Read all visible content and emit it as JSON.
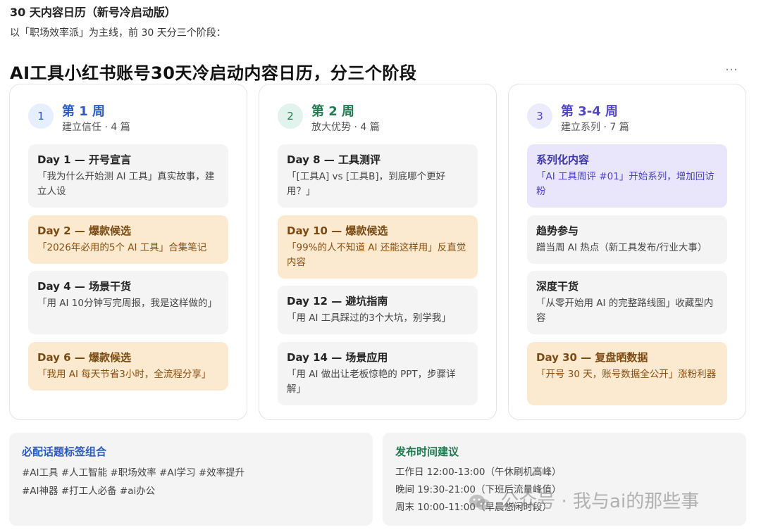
{
  "header": {
    "top_title": "30 天内容日历（新号冷启动版）",
    "intro": "以「职场效率派」为主线，前 30 天分三个阶段：",
    "main_title": "AI工具小红书账号30天冷启动内容日历，分三个阶段",
    "more_icon": "…"
  },
  "columns": [
    {
      "num": "1",
      "title": "第 1 周",
      "subtitle": "建立信任 · 4 篇",
      "cards": [
        {
          "title": "Day 1 — 开号宣言",
          "desc": "「我为什么开始测 AI 工具」真实故事，建立人设",
          "style": "gray"
        },
        {
          "title": "Day 2 — 爆款候选",
          "desc": "「2026年必用的5个 AI 工具」合集笔记",
          "style": "orange"
        },
        {
          "title": "Day 4 — 场景干货",
          "desc": "「用 AI 10分钟写完周报，我是这样做的」",
          "style": "gray"
        },
        {
          "title": "Day 6 — 爆款候选",
          "desc": "「我用 AI 每天节省3小时，全流程分享」",
          "style": "orange"
        }
      ]
    },
    {
      "num": "2",
      "title": "第 2 周",
      "subtitle": "放大优势 · 4 篇",
      "cards": [
        {
          "title": "Day 8 — 工具测评",
          "desc": "「[工具A] vs [工具B]，到底哪个更好用？」",
          "style": "gray"
        },
        {
          "title": "Day 10 — 爆款候选",
          "desc": "「99%的人不知道 AI 还能这样用」反直觉内容",
          "style": "orange"
        },
        {
          "title": "Day 12 — 避坑指南",
          "desc": "「用 AI 工具踩过的3个大坑，别学我」",
          "style": "gray"
        },
        {
          "title": "Day 14 — 场景应用",
          "desc": "「用 AI 做出让老板惊艳的 PPT，步骤详解」",
          "style": "gray"
        }
      ]
    },
    {
      "num": "3",
      "title": "第 3-4 周",
      "subtitle": "建立系列 · 7 篇",
      "cards": [
        {
          "title": "系列化内容",
          "desc": "「AI 工具周评 #01」开始系列，增加回访粉",
          "style": "purple"
        },
        {
          "title": "趋势参与",
          "desc": "蹭当周 AI 热点（新工具发布/行业大事）",
          "style": "gray"
        },
        {
          "title": "深度干货",
          "desc": "「从零开始用 AI 的完整路线图」收藏型内容",
          "style": "gray"
        },
        {
          "title": "Day 30 — 复盘晒数据",
          "desc": "「开号 30 天，账号数据全公开」涨粉利器",
          "style": "orange"
        }
      ]
    }
  ],
  "tags_panel": {
    "title": "必配话题标签组合",
    "line1": "#AI工具 #人工智能 #职场效率 #AI学习 #效率提升",
    "line2": "#AI神器 #打工人必备 #ai办公"
  },
  "time_panel": {
    "title": "发布时间建议",
    "line1": "工作日 12:00-13:00（午休刷机高峰）",
    "line2": "晚间 19:30-21:00（下班后流量峰值）",
    "line3": "周末 10:00-11:00（早晨悠闲时段）"
  },
  "watermark": {
    "text": "公众号 · 我与ai的那些事",
    "icon": "wechat-icon"
  },
  "colors": {
    "week1": "#2a5bc2",
    "week2": "#1f7a4f",
    "week3": "#5146c7",
    "orange_card": "#fbead0",
    "gray_card": "#f4f4f4",
    "purple_card": "#e9e6fb"
  }
}
